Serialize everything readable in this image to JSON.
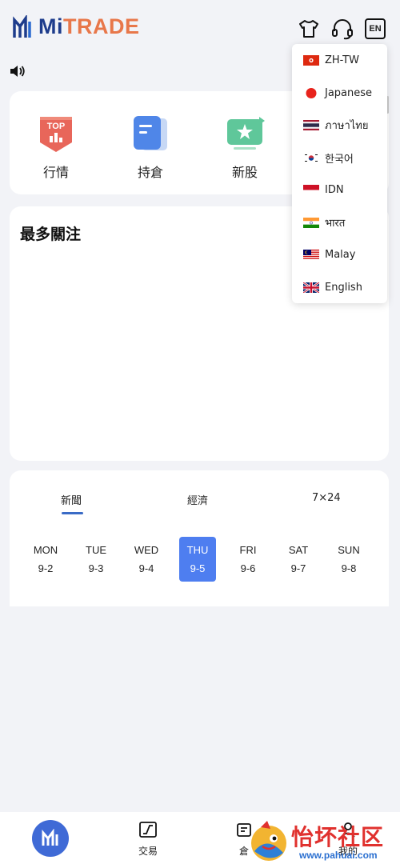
{
  "header": {
    "logo_mi": "Mi",
    "logo_trade": "TRADE",
    "lang_button": "EN",
    "icons": [
      "tshirt-icon",
      "headset-icon",
      "language-icon"
    ]
  },
  "menu": {
    "items": [
      {
        "label": "行情",
        "icon": "top-badge-icon",
        "badge": "TOP"
      },
      {
        "label": "持倉",
        "icon": "document-icon"
      },
      {
        "label": "新股",
        "icon": "star-screen-icon"
      }
    ]
  },
  "watchlist": {
    "title": "最多關注"
  },
  "news": {
    "tabs": [
      "新聞",
      "經濟",
      "7×24"
    ],
    "active_tab": 0,
    "days": [
      {
        "dow": "MON",
        "date": "9-2"
      },
      {
        "dow": "TUE",
        "date": "9-3"
      },
      {
        "dow": "WED",
        "date": "9-4"
      },
      {
        "dow": "THU",
        "date": "9-5"
      },
      {
        "dow": "FRI",
        "date": "9-6"
      },
      {
        "dow": "SAT",
        "date": "9-7"
      },
      {
        "dow": "SUN",
        "date": "9-8"
      }
    ],
    "active_day": 3
  },
  "language_menu": {
    "options": [
      {
        "label": "ZH-TW",
        "flag": "hong-kong-flag"
      },
      {
        "label": "Japanese",
        "flag": "japan-flag"
      },
      {
        "label": "ภาษาไทย",
        "flag": "thailand-flag"
      },
      {
        "label": "한국어",
        "flag": "korea-flag"
      },
      {
        "label": "IDN",
        "flag": "indonesia-flag"
      },
      {
        "label": "भारत",
        "flag": "india-flag"
      },
      {
        "label": "Malay",
        "flag": "malaysia-flag"
      },
      {
        "label": "English",
        "flag": "uk-flag"
      }
    ]
  },
  "bottom_nav": {
    "items": [
      {
        "label": "",
        "icon": "mitrade-home-icon"
      },
      {
        "label": "交易",
        "icon": "trade-chart-icon"
      },
      {
        "label": "倉",
        "icon": "position-icon"
      },
      {
        "label": "我的",
        "icon": "profile-icon"
      }
    ]
  },
  "watermark": {
    "text": "怡坏社区",
    "url": "www.pahuai.com"
  },
  "colors": {
    "brand_blue": "#1e3c8c",
    "brand_orange": "#e8774a",
    "active_day": "#4e7ef0",
    "tab_underline": "#3a6bc6"
  }
}
